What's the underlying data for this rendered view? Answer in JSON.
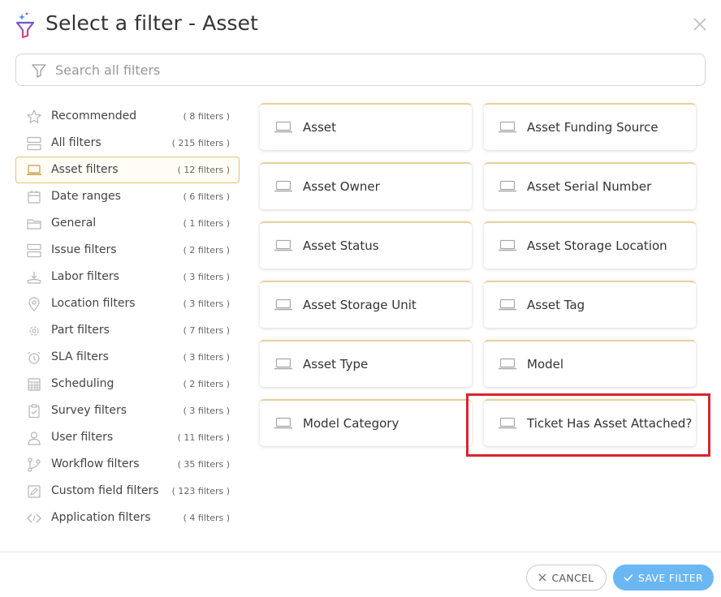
{
  "header": {
    "title": "Select a filter - Asset",
    "title_icon": "funnel-sparkle-icon",
    "close_icon": "close-icon"
  },
  "search": {
    "placeholder": "Search all filters",
    "value": "",
    "icon": "filter-icon"
  },
  "sidebar": {
    "items": [
      {
        "label": "Recommended",
        "count": "( 8 filters )",
        "icon": "star-icon",
        "active": false
      },
      {
        "label": "All filters",
        "count": "( 215 filters )",
        "icon": "list-icon",
        "active": false
      },
      {
        "label": "Asset filters",
        "count": "( 12 filters )",
        "icon": "laptop-icon",
        "active": true
      },
      {
        "label": "Date ranges",
        "count": "( 6 filters )",
        "icon": "calendar-icon",
        "active": false
      },
      {
        "label": "General",
        "count": "( 1 filters )",
        "icon": "folder-icon",
        "active": false
      },
      {
        "label": "Issue filters",
        "count": "( 2 filters )",
        "icon": "list-icon",
        "active": false
      },
      {
        "label": "Labor filters",
        "count": "( 3 filters )",
        "icon": "labor-icon",
        "active": false
      },
      {
        "label": "Location filters",
        "count": "( 3 filters )",
        "icon": "location-pin-icon",
        "active": false
      },
      {
        "label": "Part filters",
        "count": "( 7 filters )",
        "icon": "gear-icon",
        "active": false
      },
      {
        "label": "SLA filters",
        "count": "( 3 filters )",
        "icon": "alarm-clock-icon",
        "active": false
      },
      {
        "label": "Scheduling",
        "count": "( 2 filters )",
        "icon": "calendar-grid-icon",
        "active": false
      },
      {
        "label": "Survey filters",
        "count": "( 3 filters )",
        "icon": "clipboard-check-icon",
        "active": false
      },
      {
        "label": "User filters",
        "count": "( 11 filters )",
        "icon": "user-icon",
        "active": false
      },
      {
        "label": "Workflow filters",
        "count": "( 35 filters )",
        "icon": "workflow-branch-icon",
        "active": false
      },
      {
        "label": "Custom field filters",
        "count": "( 123 filters )",
        "icon": "edit-box-icon",
        "active": false
      },
      {
        "label": "Application filters",
        "count": "( 4 filters )",
        "icon": "code-brackets-icon",
        "active": false
      }
    ]
  },
  "filters": [
    {
      "label": "Asset",
      "icon": "laptop-icon"
    },
    {
      "label": "Asset Funding Source",
      "icon": "laptop-icon"
    },
    {
      "label": "Asset Owner",
      "icon": "laptop-icon"
    },
    {
      "label": "Asset Serial Number",
      "icon": "laptop-icon"
    },
    {
      "label": "Asset Status",
      "icon": "laptop-icon"
    },
    {
      "label": "Asset Storage Location",
      "icon": "laptop-icon"
    },
    {
      "label": "Asset Storage Unit",
      "icon": "laptop-icon"
    },
    {
      "label": "Asset Tag",
      "icon": "laptop-icon"
    },
    {
      "label": "Asset Type",
      "icon": "laptop-icon"
    },
    {
      "label": "Model",
      "icon": "laptop-icon"
    },
    {
      "label": "Model Category",
      "icon": "laptop-icon"
    },
    {
      "label": "Ticket Has Asset Attached?",
      "icon": "laptop-icon"
    }
  ],
  "footer": {
    "cancel_label": "CANCEL",
    "save_label": "SAVE FILTER",
    "cancel_icon": "close-icon",
    "save_icon": "checkmark-icon"
  },
  "colors": {
    "accent_gold": "#e4c46e",
    "save_blue": "#6ab7f3",
    "highlight_red": "#d7262d"
  }
}
